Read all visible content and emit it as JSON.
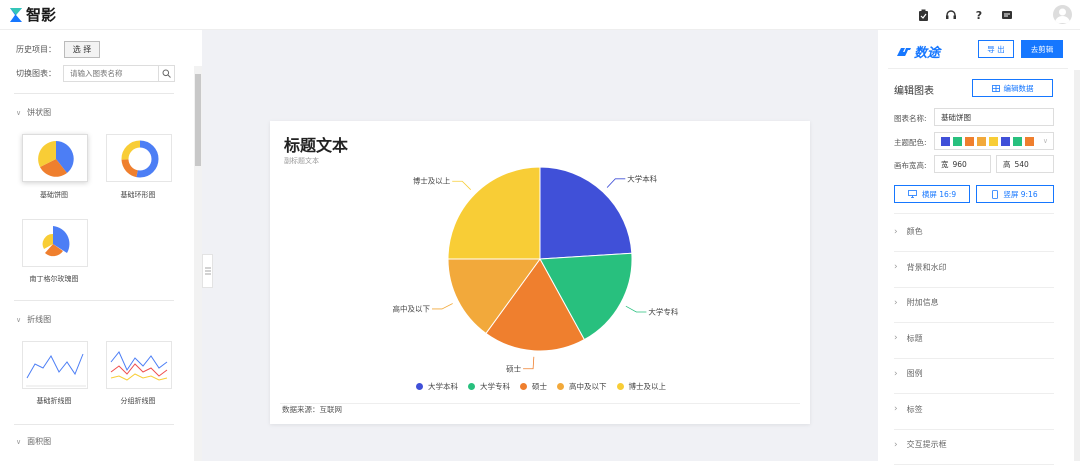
{
  "app": {
    "name": "智影"
  },
  "left": {
    "history_label": "历史项目：",
    "select_btn": "选 择",
    "switch_label": "切换图表：",
    "search_placeholder": "请输入图表名称",
    "sections": [
      {
        "label": "饼状图",
        "items": [
          "基础饼图",
          "基础环形图",
          "南丁格尔玫瑰图"
        ]
      },
      {
        "label": "折线图",
        "items": [
          "基础折线图",
          "分组折线图"
        ]
      },
      {
        "label": "面积图",
        "items": []
      }
    ]
  },
  "chart": {
    "title": "标题文本",
    "subtitle": "副标题文本",
    "footer": "数据来源：互联网"
  },
  "chart_data": {
    "type": "pie",
    "categories": [
      "大学本科",
      "大学专科",
      "硕士",
      "高中及以下",
      "博士及以上"
    ],
    "values": [
      24,
      18,
      18,
      15,
      25
    ],
    "colors": [
      "#4050d8",
      "#28c07e",
      "#ef7f2e",
      "#f2a93b",
      "#f8cd36"
    ],
    "legend": "bottom"
  },
  "right": {
    "brand": "数途",
    "export_btn": "导 出",
    "edit_btn": "去剪辑",
    "edit_chart": "编辑图表",
    "edit_data_btn": "编辑数据",
    "name_label": "图表名称:",
    "name_value": "基础饼图",
    "theme_label": "主题配色:",
    "theme_colors": [
      "#4050d8",
      "#28c07e",
      "#ef7f2e",
      "#f2a93b",
      "#f8cd36",
      "#4050d8",
      "#28c07e",
      "#ef7f2e"
    ],
    "size_label": "画布宽高:",
    "width_prefix": "宽",
    "width_value": "960",
    "height_prefix": "高",
    "height_value": "540",
    "landscape_btn": "横屏 16:9",
    "portrait_btn": "竖屏 9:16",
    "accordions": [
      "颜色",
      "背景和水印",
      "附加信息",
      "标题",
      "图例",
      "标签",
      "交互提示框"
    ]
  }
}
